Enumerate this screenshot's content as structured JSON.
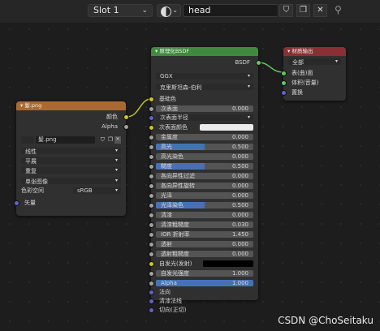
{
  "toolbar": {
    "slot_label": "Slot 1",
    "chevron": "⌄",
    "material_name": "head",
    "icons": [
      "shield-icon",
      "duplicate-icon",
      "close-icon",
      "pin-icon"
    ]
  },
  "image_node": {
    "title": "髮.png",
    "out_color": "颜色",
    "out_alpha": "Alpha",
    "image_name": "髮.png",
    "interpolation": "线性",
    "projection": "平展",
    "extension": "重复",
    "source": "单张图像",
    "colorspace_label": "色彩空间",
    "colorspace_value": "sRGB",
    "vector": "矢量"
  },
  "bsdf_node": {
    "title": "原理化BSDF",
    "out_bsdf": "BSDF",
    "distribution": "GGX",
    "subsurface_method": "克里斯坦森-伯利",
    "base_color": "基础色",
    "subsurface": {
      "label": "次表面",
      "value": "0.000"
    },
    "subsurface_radius": "次表面半径",
    "subsurface_color": "次表面颜色",
    "metallic": {
      "label": "金属度",
      "value": "0.000"
    },
    "specular": {
      "label": "高光",
      "value": "0.500",
      "fill": 0.5
    },
    "specular_tint": {
      "label": "高光染色",
      "value": "0.000"
    },
    "roughness": {
      "label": "糙度",
      "value": "0.500",
      "fill": 0.5
    },
    "anisotropic": {
      "label": "各向异性过滤",
      "value": "0.000"
    },
    "anisotropic_rotation": {
      "label": "各向异性旋转",
      "value": "0.000"
    },
    "sheen": {
      "label": "光泽",
      "value": "0.000"
    },
    "sheen_tint": {
      "label": "光泽染色",
      "value": "0.500",
      "fill": 0.5
    },
    "clearcoat": {
      "label": "清漆",
      "value": "0.000"
    },
    "clearcoat_roughness": {
      "label": "清漆粗糙度",
      "value": "0.030"
    },
    "ior": {
      "label": "IOR 折射率",
      "value": "1.450"
    },
    "transmission": {
      "label": "透射",
      "value": "0.000"
    },
    "transmission_roughness": {
      "label": "透射粗糙度",
      "value": "0.000"
    },
    "emission": "自发光(发射)",
    "emission_strength": {
      "label": "自发光强度",
      "value": "1.000"
    },
    "alpha": {
      "label": "Alpha",
      "value": "1.000",
      "fill": 1.0
    },
    "normal": "法向",
    "clearcoat_normal": "清漆法线",
    "tangent": "切向(正切)"
  },
  "output_node": {
    "title": "材质输出",
    "target": "全部",
    "surface": "表(曲)面",
    "volume": "体积(音量)",
    "displacement": "置换"
  },
  "watermark": "CSDN @ChoSeitaku",
  "colors": {
    "image_header": "#a86a35",
    "bsdf_header": "#3f8a3f",
    "output_header": "#8a3034",
    "socket_color": "#c7c729",
    "socket_float": "#a1a1a1",
    "socket_vector": "#6363c7",
    "socket_shader": "#63c763",
    "accent_blue": "#4672b4"
  }
}
